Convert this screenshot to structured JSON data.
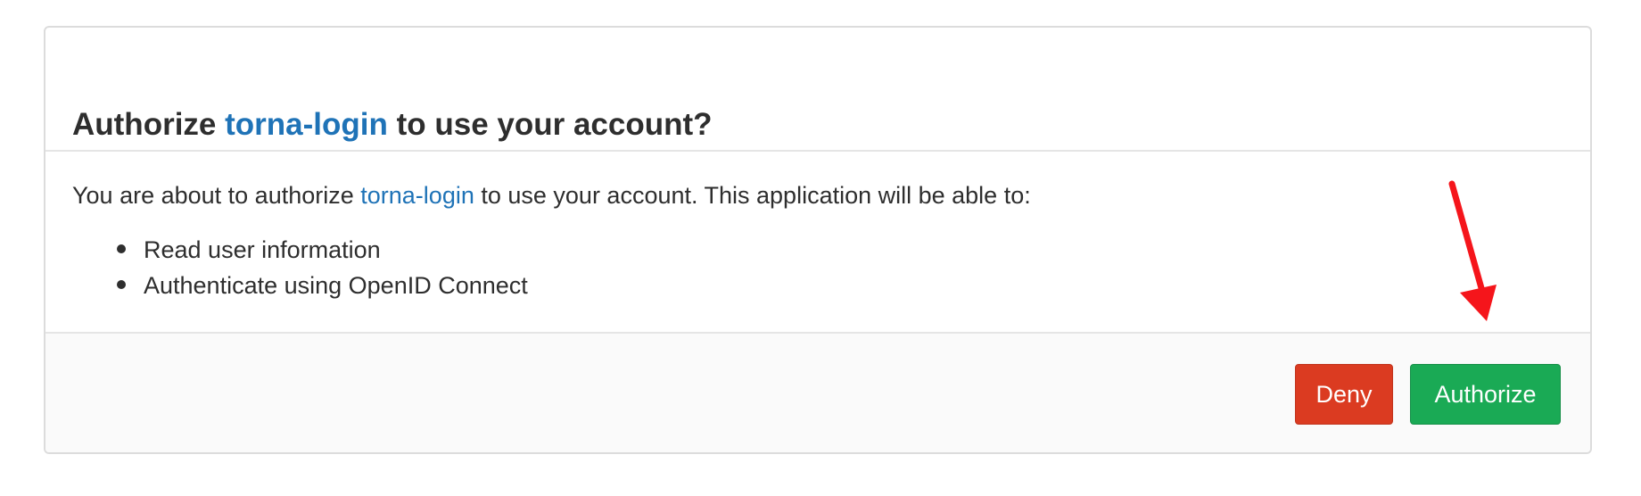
{
  "dialog": {
    "title_prefix": "Authorize",
    "app_name": "torna-login",
    "title_suffix": "to use your account?",
    "intro_prefix": "You are about to authorize",
    "intro_app_name": "torna-login",
    "intro_suffix": "to use your account. This application will be able to:",
    "permissions": [
      "Read user information",
      "Authenticate using OpenID Connect"
    ]
  },
  "actions": {
    "deny_label": "Deny",
    "authorize_label": "Authorize"
  },
  "annotation": {
    "arrow_color": "#f5151b",
    "arrow_target": "authorize-button"
  },
  "colors": {
    "link": "#1f73b7",
    "deny": "#db3b21",
    "authorize": "#1aaa55"
  }
}
